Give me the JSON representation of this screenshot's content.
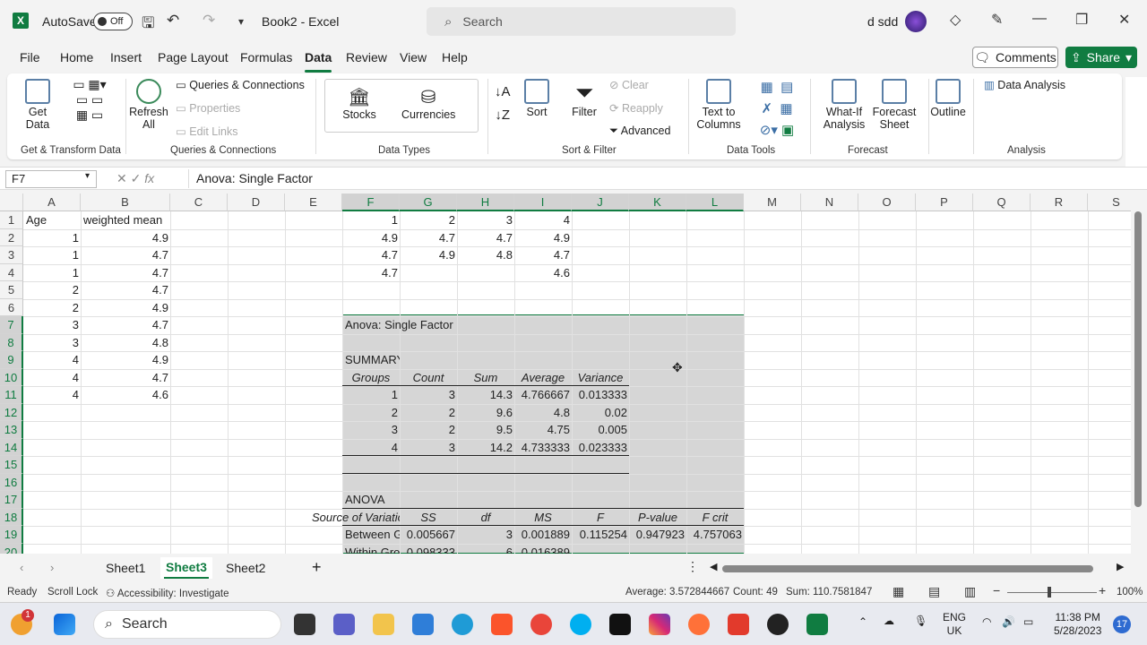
{
  "title_bar": {
    "autosave_label": "AutoSave",
    "autosave_state": "Off",
    "doc_title": "Book2  -  Excel",
    "search_placeholder": "Search",
    "user_name": "d sdd"
  },
  "menu": {
    "tabs": [
      "File",
      "Home",
      "Insert",
      "Page Layout",
      "Formulas",
      "Data",
      "Review",
      "View",
      "Help"
    ],
    "active": "Data",
    "comments_label": "Comments",
    "share_label": "Share"
  },
  "ribbon": {
    "get_data": "Get Data",
    "refresh_all": "Refresh All",
    "queries_connections": "Queries & Connections",
    "properties": "Properties",
    "edit_links": "Edit Links",
    "stocks": "Stocks",
    "currencies": "Currencies",
    "sort": "Sort",
    "filter": "Filter",
    "clear": "Clear",
    "reapply": "Reapply",
    "advanced": "Advanced",
    "text_to_columns": "Text to Columns",
    "what_if": "What-If Analysis",
    "forecast_sheet": "Forecast Sheet",
    "outline": "Outline",
    "data_analysis": "Data Analysis",
    "groups": [
      "Get & Transform Data",
      "Queries & Connections",
      "Data Types",
      "Sort & Filter",
      "Data Tools",
      "Forecast",
      "Analysis"
    ]
  },
  "formula_bar": {
    "name_box": "F7",
    "formula": "Anova: Single Factor"
  },
  "columns": [
    "A",
    "B",
    "C",
    "D",
    "E",
    "F",
    "G",
    "H",
    "I",
    "J",
    "K",
    "L",
    "M",
    "N",
    "O",
    "P",
    "Q",
    "R",
    "S"
  ],
  "rows": [
    "1",
    "2",
    "3",
    "4",
    "5",
    "6",
    "7",
    "8",
    "9",
    "10",
    "11",
    "12",
    "13",
    "14",
    "15",
    "16",
    "17",
    "18",
    "19",
    "20"
  ],
  "cells": {
    "A1": "Age",
    "B1": "weighted  mean",
    "A2": "1",
    "B2": "4.9",
    "A3": "1",
    "B3": "4.7",
    "A4": "1",
    "B4": "4.7",
    "A5": "2",
    "B5": "4.7",
    "A6": "2",
    "B6": "4.9",
    "A7": "3",
    "B7": "4.7",
    "A8": "3",
    "B8": "4.8",
    "A9": "4",
    "B9": "4.9",
    "A10": "4",
    "B10": "4.7",
    "A11": "4",
    "B11": "4.6",
    "F1": "1",
    "G1": "2",
    "H1": "3",
    "I1": "4",
    "F2": "4.9",
    "G2": "4.7",
    "H2": "4.7",
    "I2": "4.9",
    "F3": "4.7",
    "G3": "4.9",
    "H3": "4.8",
    "I3": "4.7",
    "F4": "4.7",
    "I4": "4.6",
    "F7": "Anova: Single Factor",
    "F9": "SUMMARY",
    "F10": "Groups",
    "G10": "Count",
    "H10": "Sum",
    "I10": "Average",
    "J10": "Variance",
    "F11": "1",
    "G11": "3",
    "H11": "14.3",
    "I11": "4.766667",
    "J11": "0.013333",
    "F12": "2",
    "G12": "2",
    "H12": "9.6",
    "I12": "4.8",
    "J12": "0.02",
    "F13": "3",
    "G13": "2",
    "H13": "9.5",
    "I13": "4.75",
    "J13": "0.005",
    "F14": "4",
    "G14": "3",
    "H14": "14.2",
    "I14": "4.733333",
    "J14": "0.023333",
    "F17": "ANOVA",
    "F18": "Source of Variation",
    "G18": "SS",
    "H18": "df",
    "I18": "MS",
    "J18": "F",
    "K18": "P-value",
    "L18": "F crit",
    "F19": "Between Groups",
    "G19": "0.005667",
    "H19": "3",
    "I19": "0.001889",
    "J19": "0.115254",
    "K19": "0.947923",
    "L19": "4.757063",
    "F20": "Within Groups",
    "G20": "0.098333",
    "H20": "6",
    "I20": "0.016389"
  },
  "sheets": [
    "Sheet1",
    "Sheet3",
    "Sheet2"
  ],
  "active_sheet": "Sheet3",
  "status": {
    "ready": "Ready",
    "scroll_lock": "Scroll Lock",
    "accessibility": "Accessibility: Investigate",
    "average": "Average: 3.572844667",
    "count": "Count: 49",
    "sum": "Sum: 110.7581847",
    "zoom": "100%"
  },
  "taskbar": {
    "search": "Search",
    "lang1": "ENG",
    "lang2": "UK",
    "time": "11:38 PM",
    "date": "5/28/2023",
    "notif_count": "17",
    "start_badge": "1"
  },
  "colors": {
    "accent": "#107c41",
    "selection": "#d2d2d2"
  }
}
